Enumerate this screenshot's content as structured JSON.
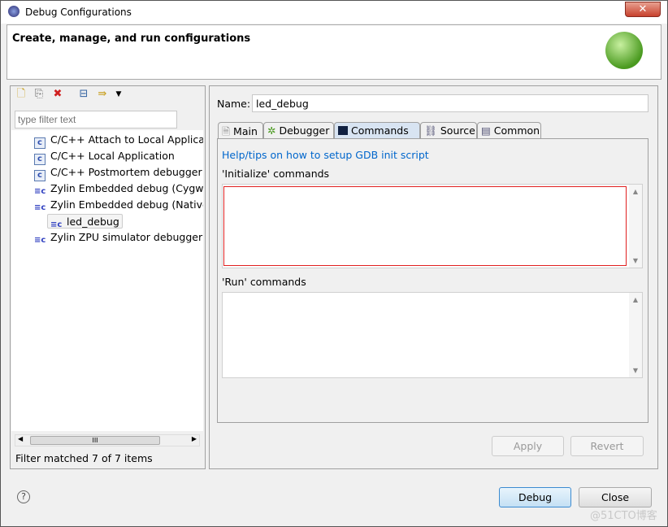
{
  "window": {
    "title": "Debug Configurations",
    "close": "✕"
  },
  "banner": {
    "title": "Create, manage, and run configurations"
  },
  "left": {
    "filter_placeholder": "type filter text",
    "items": [
      {
        "label": "C/C++ Attach to Local Applicatio",
        "icon": "c-app-icon"
      },
      {
        "label": "C/C++ Local Application",
        "icon": "c-app-icon"
      },
      {
        "label": "C/C++ Postmortem debugger",
        "icon": "c-app-icon"
      },
      {
        "label": "Zylin Embedded debug (Cygwin",
        "icon": "zylin-icon"
      },
      {
        "label": "Zylin Embedded debug (Native)",
        "icon": "zylin-icon"
      },
      {
        "label": "led_debug",
        "icon": "zylin-icon"
      },
      {
        "label": "Zylin ZPU simulator debugger (C",
        "icon": "zylin-icon"
      }
    ],
    "scroll_thumb": "III",
    "status": "Filter matched 7 of 7 items"
  },
  "right": {
    "name_label": "Name:",
    "name_value": "led_debug",
    "tabs": [
      "Main",
      "Debugger",
      "Commands",
      "Source",
      "Common"
    ],
    "active_tab": "Commands",
    "help_link": "Help/tips on how to setup GDB init script",
    "init_label": "'Initialize' commands",
    "init_value": "",
    "run_label": "'Run' commands",
    "run_value": "",
    "apply": "Apply",
    "revert": "Revert"
  },
  "footer": {
    "debug": "Debug",
    "close": "Close",
    "help": "?"
  },
  "watermark": "@51CTO博客"
}
